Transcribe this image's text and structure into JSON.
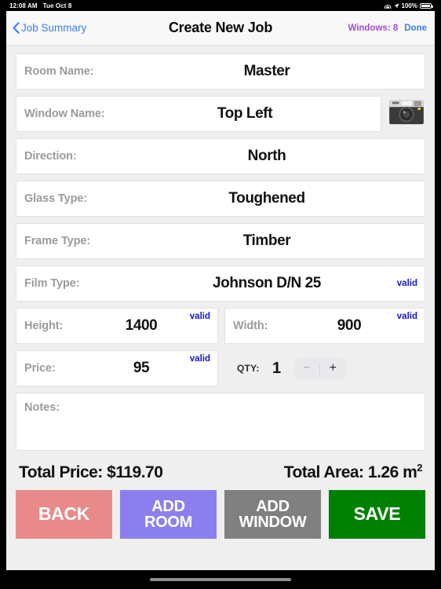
{
  "statusbar": {
    "time": "12:08 AM",
    "date": "Tue Oct 8",
    "battery_percent": "100%",
    "wifi_icon": "wifi-icon",
    "location_icon": "location-arrow-icon",
    "battery_icon": "battery-full-icon"
  },
  "nav": {
    "back_label": "Job Summary",
    "title": "Create New Job",
    "windows_count_label": "Windows: 8",
    "done_label": "Done",
    "back_chevron_icon": "chevron-left-icon",
    "accent_blue": "#3C7EE8",
    "accent_purple": "#A34DD6"
  },
  "form": {
    "valid_badge": "valid",
    "valid_color": "#1414E0",
    "camera_icon": "camera-icon",
    "fields": {
      "room_name": {
        "label": "Room Name:",
        "value": "Master"
      },
      "window_name": {
        "label": "Window Name:",
        "value": "Top Left"
      },
      "direction": {
        "label": "Direction:",
        "value": "North"
      },
      "glass_type": {
        "label": "Glass Type:",
        "value": "Toughened"
      },
      "frame_type": {
        "label": "Frame Type:",
        "value": "Timber"
      },
      "film_type": {
        "label": "Film Type:",
        "value": "Johnson D/N 25"
      },
      "height": {
        "label": "Height:",
        "value": "1400"
      },
      "width": {
        "label": "Width:",
        "value": "900"
      },
      "price": {
        "label": "Price:",
        "value": "95"
      },
      "notes": {
        "label": "Notes:",
        "value": ""
      }
    },
    "qty": {
      "label": "QTY:",
      "value": "1",
      "decrement_label": "−",
      "increment_label": "+"
    }
  },
  "totals": {
    "price_label": "Total Price: $119.70",
    "area_label": "Total Area: 1.26 m",
    "area_exponent": "2"
  },
  "buttons": [
    {
      "label": "BACK",
      "name": "back-button",
      "color": "#E88A8A",
      "lines": 1
    },
    {
      "label": "ADD\nROOM",
      "name": "add-room-button",
      "color": "#8B7FEE",
      "lines": 2
    },
    {
      "label": "ADD\nWINDOW",
      "name": "add-window-button",
      "color": "#808080",
      "lines": 2
    },
    {
      "label": "SAVE",
      "name": "save-button",
      "color": "#008000",
      "lines": 1
    }
  ]
}
